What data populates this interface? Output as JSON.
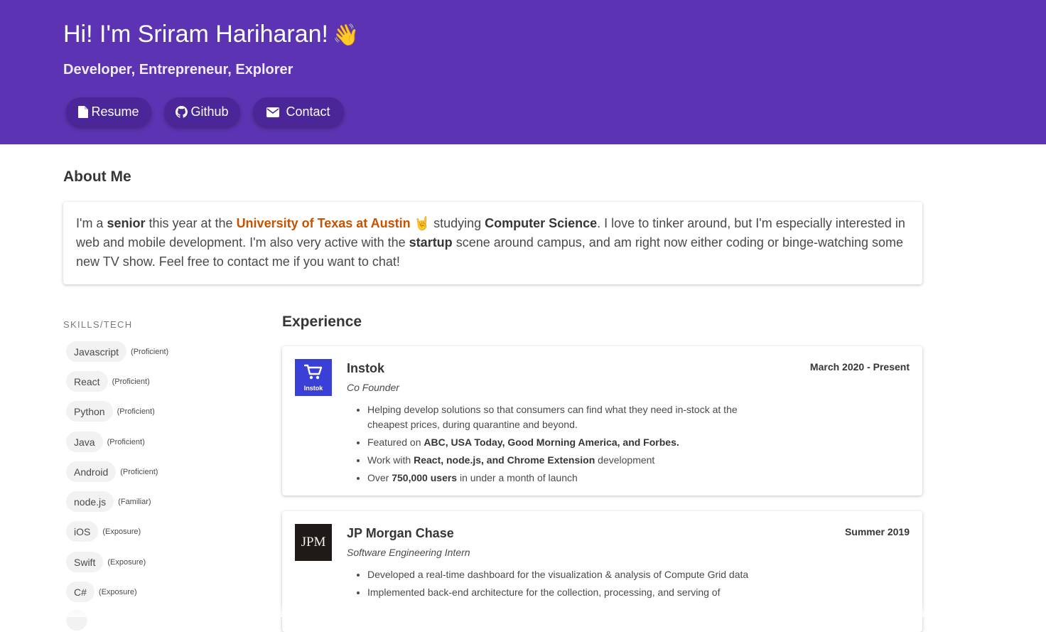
{
  "hero": {
    "title": "Hi! I'm Sriram Hariharan!",
    "wave_emoji": "👋",
    "subtitle": "Developer, Entrepreneur, Explorer",
    "background_color": "#5c33b2",
    "buttons": [
      {
        "label": "Resume",
        "icon": "file-icon"
      },
      {
        "label": "Github",
        "icon": "github-icon"
      },
      {
        "label": "Contact",
        "icon": "envelope-icon"
      }
    ]
  },
  "about": {
    "title": "About Me",
    "parts": {
      "p1": "I'm a ",
      "b1": "senior",
      "p2": " this year at the ",
      "university": "University of Texas at Austin",
      "hook_emoji": "🤘",
      "p3": " studying ",
      "b2": "Computer Science",
      "p4": ". I love to tinker around, but I'm especially interested in web and mobile development. I'm also very active with the ",
      "b3": "startup",
      "p5": " scene around campus, and am right now either coding or binge-watching some new TV show. Feel free to contact me if you want to chat!"
    },
    "university_color": "#c75200"
  },
  "skills": {
    "title": "SKILLS/TECH",
    "items": [
      {
        "name": "Javascript",
        "level": "(Proficient)"
      },
      {
        "name": "React",
        "level": "(Proficient)"
      },
      {
        "name": "Python",
        "level": "(Proficient)"
      },
      {
        "name": "Java",
        "level": "(Proficient)"
      },
      {
        "name": "Android",
        "level": "(Proficient)"
      },
      {
        "name": "node.js",
        "level": "(Familiar)"
      },
      {
        "name": "iOS",
        "level": "(Exposure)"
      },
      {
        "name": "Swift",
        "level": "(Exposure)"
      },
      {
        "name": "C#",
        "level": "(Exposure)"
      }
    ]
  },
  "experience": {
    "title": "Experience",
    "jobs": [
      {
        "company": "Instok",
        "logo_text": "Instok",
        "role": "Co Founder",
        "dates": "March 2020 - Present",
        "bullets": {
          "b1": "Helping develop solutions so that consumers can find what they need in-stock at the cheapest prices, during quarantine and beyond.",
          "b2_pre": "Featured on ",
          "b2_bold": "ABC, USA Today, Good Morning America, and Forbes.",
          "b3_pre": "Work with ",
          "b3_bold": "React, node.js, and Chrome Extension",
          "b3_post": " development",
          "b4_pre": "Over ",
          "b4_bold": "750,000 users",
          "b4_post": " in under a month of launch"
        }
      },
      {
        "company": "JP Morgan Chase",
        "logo_text": "JPM",
        "role": "Software Engineering Intern",
        "dates": "Summer 2019",
        "bullets": {
          "b1": "Developed a real-time dashboard for the visualization & analysis of Compute Grid data",
          "b2": "Implemented back-end architecture for the collection, processing, and serving of"
        }
      }
    ]
  }
}
